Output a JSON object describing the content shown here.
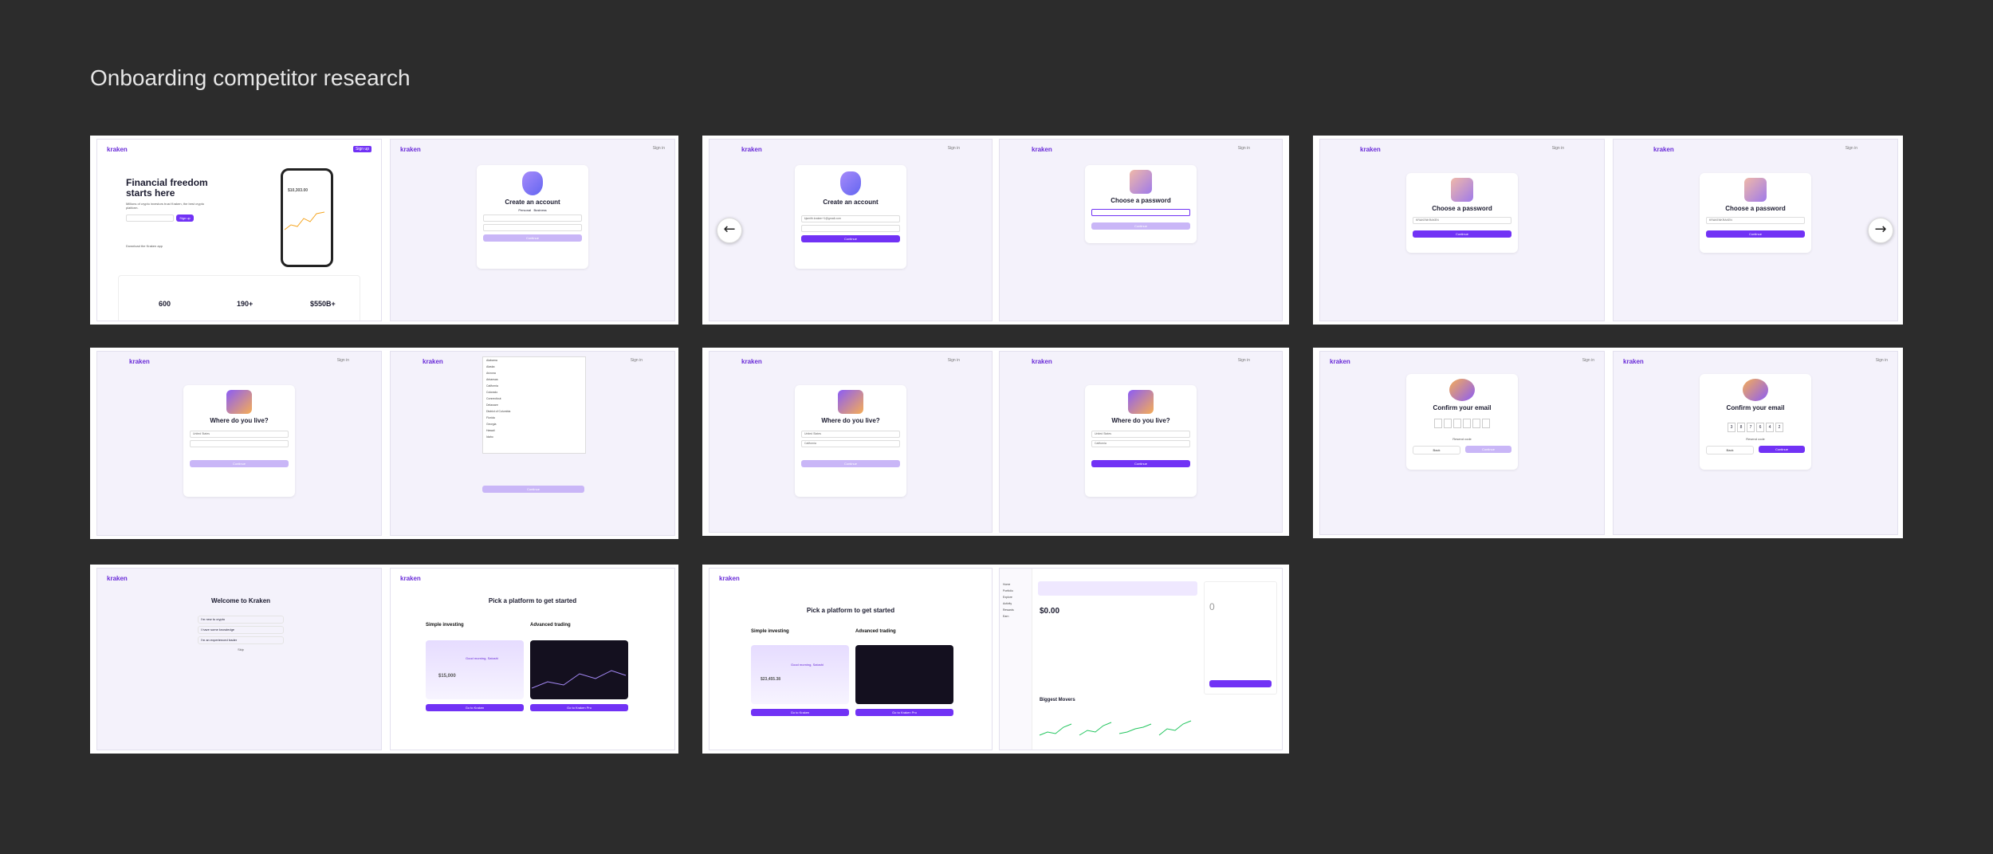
{
  "page_title": "Onboarding competitor research",
  "brand": "kraken",
  "colors": {
    "background": "#2c2c2c",
    "accent": "#7132f5",
    "panel": "#f4f2fb"
  },
  "nav": {
    "prev_icon": "arrow-left-icon",
    "next_icon": "arrow-right-icon",
    "prev_glyph": "←",
    "next_glyph": "→"
  },
  "common": {
    "sign_in": "Sign in",
    "back": "Back",
    "continue": "Continue",
    "resend": "Resend code"
  },
  "landing": {
    "headline": "Financial freedom starts here",
    "sub": "Millions of crypto investors trust Kraken, the best crypto platform.",
    "cta": "Sign up",
    "app": "Download the Kraken app",
    "phone_balance": "$10,303.00",
    "stats": [
      "600",
      "190+",
      "$550B+"
    ]
  },
  "create_account": {
    "title": "Create an account",
    "tabs": [
      "Personal",
      "Business"
    ],
    "email_value": "kjsmith.kraken+1@gmail.com"
  },
  "password": {
    "title": "Choose a password",
    "value": "KRAKENKRAKEN"
  },
  "where_live": {
    "title": "Where do you live?",
    "country": "United States",
    "state": "California",
    "states": [
      "Alabama",
      "Alaska",
      "Arizona",
      "Arkansas",
      "California",
      "Colorado",
      "Connecticut",
      "Delaware",
      "District of Columbia",
      "Florida",
      "Georgia",
      "Hawaii",
      "Idaho"
    ]
  },
  "confirm_email": {
    "title": "Confirm your email",
    "digits": [
      "3",
      "8",
      "7",
      "6",
      "4",
      "2"
    ]
  },
  "welcome": {
    "title": "Welcome to Kraken",
    "options": [
      "I'm new to crypto",
      "I have some knowledge",
      "I'm an experienced trader"
    ],
    "skip": "Skip"
  },
  "platform": {
    "title": "Pick a platform to get started",
    "simple": "Simple investing",
    "advanced": "Advanced trading",
    "greeting": "Good morning, Satoshi",
    "amount": "$15,000",
    "amount2": "$23,455.38",
    "simple_btn": "Go to Kraken",
    "advanced_btn": "Go to Kraken Pro"
  },
  "dashboard": {
    "balance": "$0.00",
    "movers_title": "Biggest Movers",
    "side": [
      "Home",
      "Portfolio",
      "Explore",
      "Activity",
      "Rewards",
      "Earn"
    ],
    "trade_value": "0"
  }
}
